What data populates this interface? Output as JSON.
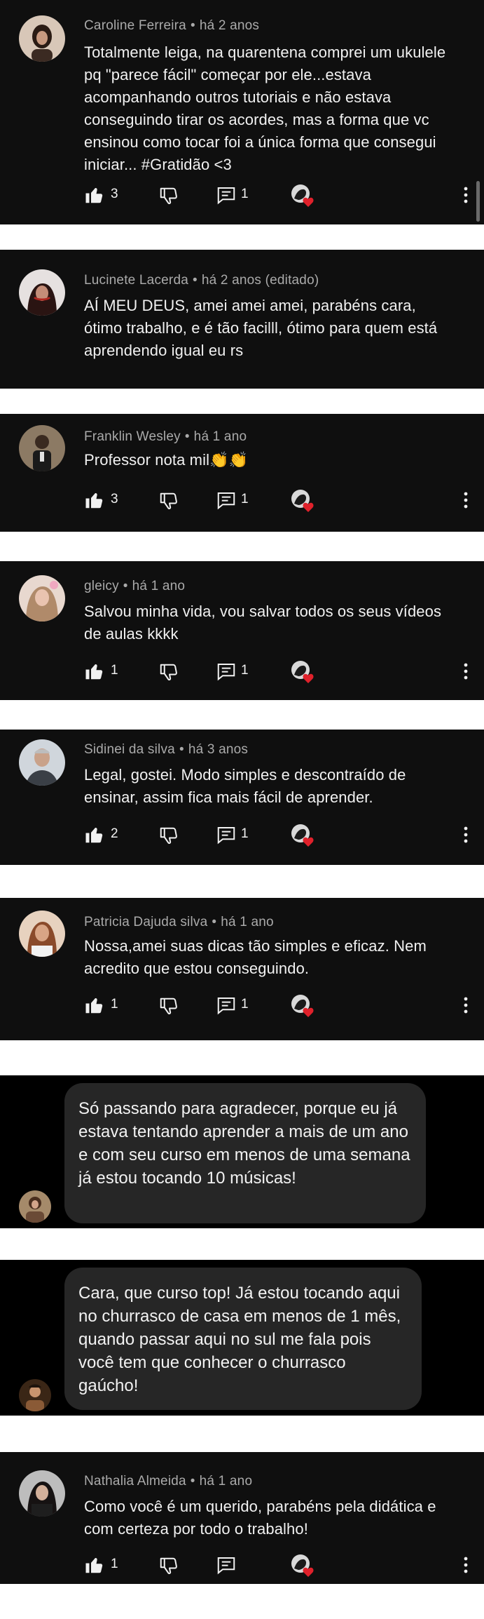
{
  "comments": [
    {
      "author": "Caroline Ferreira",
      "time": "há 2 anos",
      "text": "Totalmente leiga, na quarentena comprei um ukulele pq \"parece fácil\" começar por ele...estava acompanhando outros tutoriais e não estava conseguindo tirar os acordes, mas a forma que vc ensinou como tocar foi a única forma que consegui iniciar... #Gratidão <3",
      "likes": "3",
      "replies": "1",
      "avatar_color": "#6b4a3a"
    },
    {
      "author": "Lucinete Lacerda",
      "time": "há 2 anos (editado)",
      "text": "AÍ MEU DEUS, amei amei amei, parabéns cara, ótimo trabalho, e é tão facilll, ótimo para quem está aprendendo igual eu rs",
      "avatar_color": "#3a2a2a"
    },
    {
      "author": "Franklin Wesley",
      "time": "há 1 ano",
      "text": "Professor nota mil👏👏",
      "likes": "3",
      "replies": "1",
      "avatar_color": "#5a4a3a"
    },
    {
      "author": "gleicy",
      "time": "há 1 ano",
      "text": "Salvou minha vida, vou salvar todos os seus vídeos de aulas kkkk",
      "likes": "1",
      "replies": "1",
      "avatar_color": "#c9a89a"
    },
    {
      "author": "Sidinei da silva",
      "time": "há 3 anos",
      "text": "Legal, gostei. Modo simples e descontraído de ensinar, assim fica mais fácil de aprender.",
      "likes": "2",
      "replies": "1",
      "avatar_color": "#8a8a8a"
    },
    {
      "author": "Patricia Dajuda silva",
      "time": "há 1 ano",
      "text": "Nossa,amei suas dicas tão simples e eficaz. Nem acredito que estou conseguindo.",
      "likes": "1",
      "replies": "1",
      "avatar_color": "#a5704f"
    },
    {
      "author": "Nathalia Almeida",
      "time": "há 1 ano",
      "text": "Como você é um querido, parabéns pela didática e com certeza por todo o trabalho!",
      "likes": "1",
      "replies": "",
      "avatar_color": "#4a3a3a"
    }
  ],
  "messages": [
    {
      "text": "Só passando para agradecer, porque eu já estava tentando aprender a mais de um ano e com seu curso em menos de uma semana já estou tocando 10 músicas!",
      "avatar_color": "#5a4030"
    },
    {
      "text": "Cara, que curso top! Já estou tocando aqui no churrasco de casa em menos de 1 mês, quando passar aqui no sul me fala pois você tem que conhecer o churrasco gaúcho!",
      "avatar_color": "#4a3020"
    }
  ],
  "icons": {
    "like": "thumbs-up-icon",
    "dislike": "thumbs-down-icon",
    "reply": "reply-icon",
    "creator_heart": "creator-heart-icon",
    "more": "more-vertical-icon"
  },
  "colors": {
    "panel_bg": "#0f0f0f",
    "bubble_bg": "#262626",
    "meta_text": "#aaaaaa",
    "heart": "#e0212b"
  }
}
